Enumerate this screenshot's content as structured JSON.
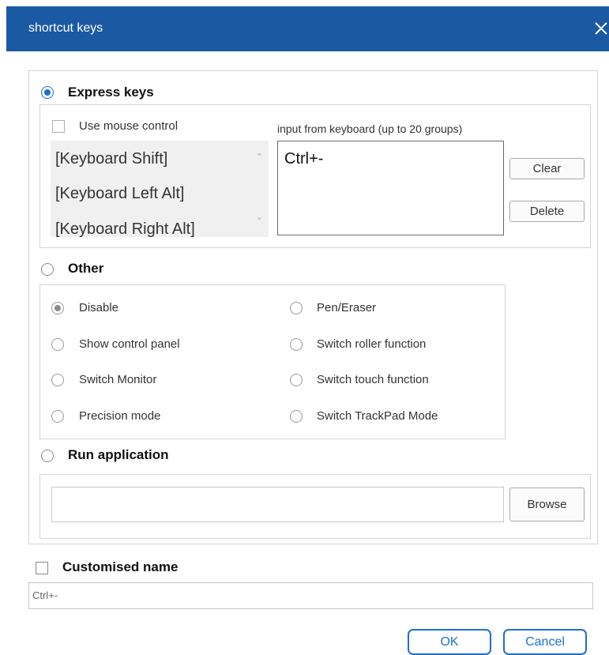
{
  "dialog": {
    "title": "shortcut keys"
  },
  "express": {
    "label": "Express keys",
    "use_mouse_label": "Use mouse control",
    "input_label": "input from keyboard (up to 20 groups)",
    "keys": [
      "[Keyboard Shift]",
      "[Keyboard Left Alt]",
      "[Keyboard Right Alt]"
    ],
    "input_value": "Ctrl+-",
    "clear_label": "Clear",
    "delete_label": "Delete"
  },
  "other": {
    "label": "Other",
    "options_left": [
      "Disable",
      "Show control panel",
      "Switch Monitor",
      "Precision mode"
    ],
    "options_right": [
      "Pen/Eraser",
      "Switch roller function",
      "Switch touch function",
      "Switch TrackPad Mode"
    ],
    "selected": "Disable"
  },
  "run_app": {
    "label": "Run application",
    "path_value": "",
    "browse_label": "Browse"
  },
  "custom_name": {
    "label": "Customised name",
    "value": "Ctrl+-"
  },
  "footer": {
    "ok_label": "OK",
    "cancel_label": "Cancel"
  },
  "colors": {
    "titlebar": "#1b59a3",
    "accent": "#1b6fd0"
  }
}
